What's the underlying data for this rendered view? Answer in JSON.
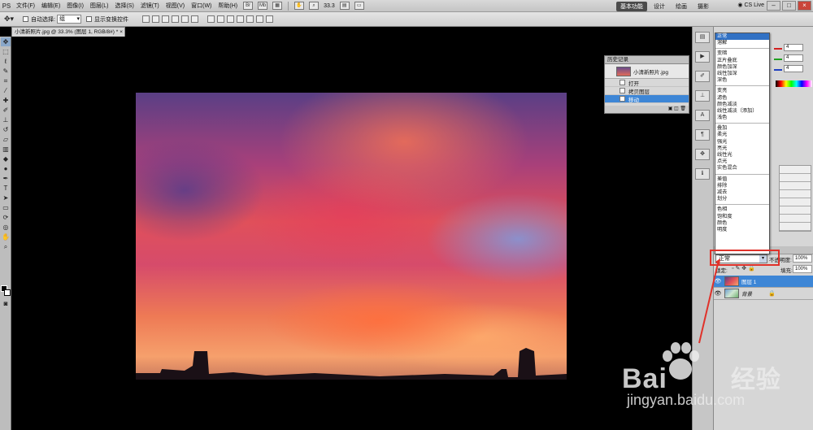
{
  "app": {
    "logo": "PS",
    "menus": [
      "文件(F)",
      "编辑(E)",
      "图像(I)",
      "图层(L)",
      "选择(S)",
      "滤镜(T)",
      "视图(V)",
      "窗口(W)",
      "帮助(H)"
    ],
    "zoom": "33.3",
    "workspaces": [
      "基本功能",
      "设计",
      "绘画",
      "摄影"
    ],
    "active_workspace": "基本功能",
    "cs_live": "CS Live"
  },
  "options_bar": {
    "auto_select_label": "自动选择:",
    "auto_select_value": "组",
    "show_transform_label": "显示变换控件"
  },
  "document": {
    "tab_title": "小清新照片.jpg @ 33.3% (图层 1, RGB/8#) *",
    "tab_close": "×"
  },
  "history_panel": {
    "title": "历史记录",
    "snapshot": "小清新照片.jpg",
    "steps": [
      "打开",
      "拷贝图层",
      "移动"
    ],
    "active_step": "移动"
  },
  "color_panel": {
    "values": [
      "4",
      "4",
      "4"
    ],
    "colors": [
      "#d32020",
      "#20a020",
      "#2040c0"
    ]
  },
  "blend_list": {
    "groups": [
      [
        "正常",
        "溶解"
      ],
      [
        "变暗",
        "正片叠底",
        "颜色加深",
        "线性加深",
        "深色"
      ],
      [
        "变亮",
        "滤色",
        "颜色减淡",
        "线性减淡（添加）",
        "浅色"
      ],
      [
        "叠加",
        "柔光",
        "强光",
        "亮光",
        "线性光",
        "点光",
        "实色混合"
      ],
      [
        "差值",
        "排除",
        "减去",
        "划分"
      ],
      [
        "色相",
        "饱和度",
        "颜色",
        "明度"
      ]
    ],
    "highlighted": "正常"
  },
  "layers_panel": {
    "blend_mode": "正常",
    "opacity_label": "不透明度:",
    "opacity_value": "100%",
    "lock_label": "锁定:",
    "fill_label": "填充:",
    "fill_value": "100%",
    "layers": [
      {
        "name": "图层 1",
        "selected": true
      },
      {
        "name": "背景",
        "selected": false
      }
    ]
  },
  "watermark": {
    "brand_latin": "Bai",
    "brand_cn": "经验",
    "url": "jingyan.baidu.com"
  },
  "colors": {
    "highlight": "#3171c4",
    "callout": "#e0322a"
  }
}
